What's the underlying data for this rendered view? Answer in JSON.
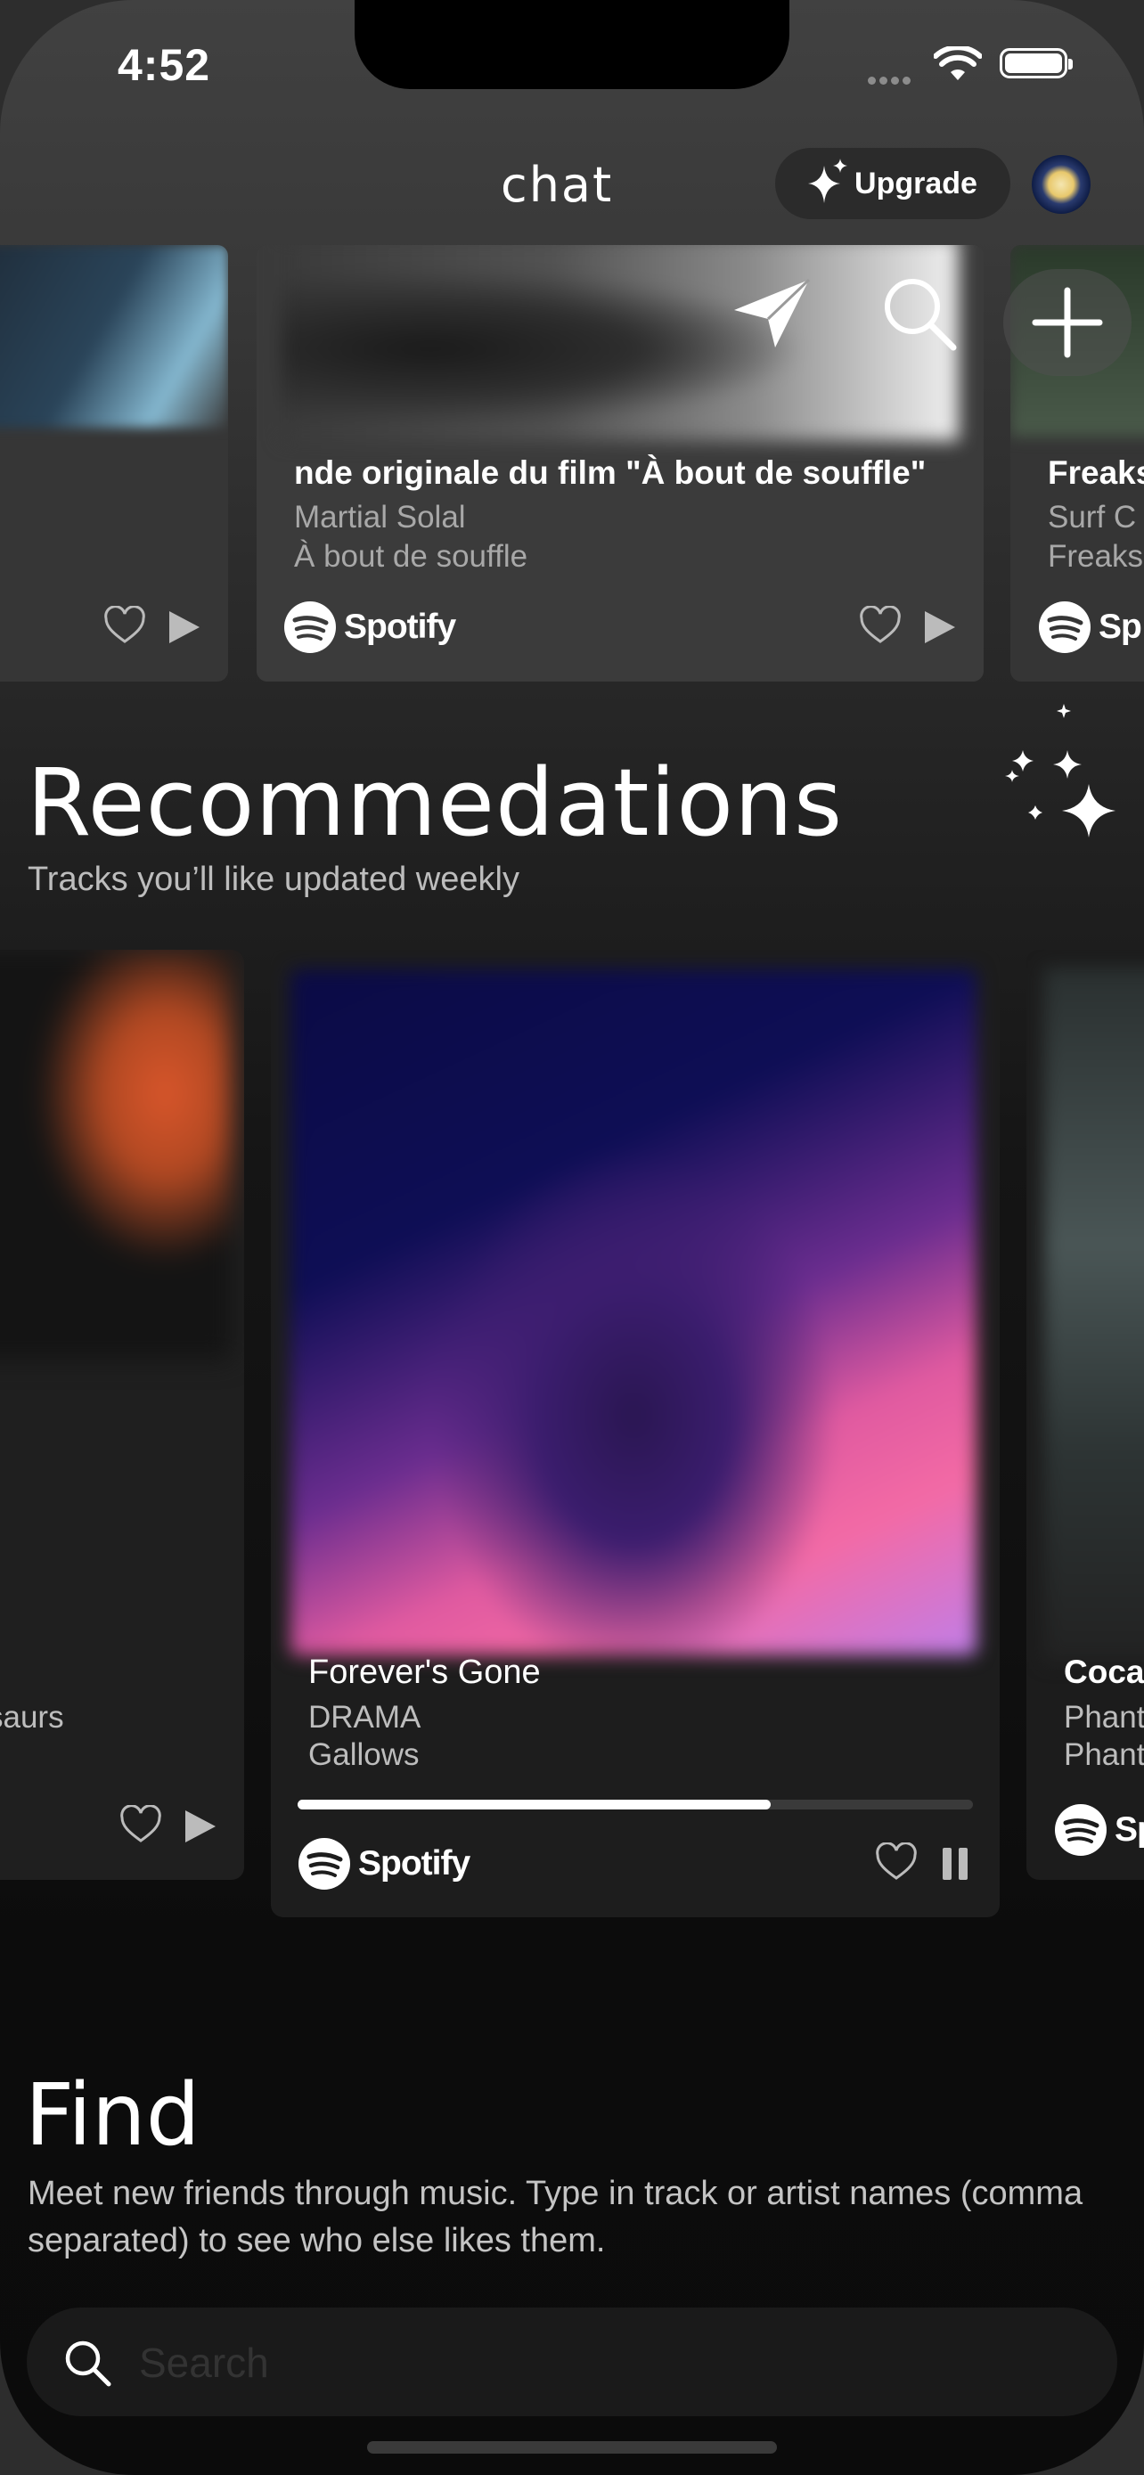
{
  "status_bar": {
    "time": "4:52"
  },
  "header": {
    "title": "chat",
    "upgrade_label": "Upgrade"
  },
  "top_cards": [
    {
      "title": "",
      "artist": "",
      "album": ""
    },
    {
      "title": "nde originale du film \"À bout de souffle\"",
      "artist": "Martial Solal",
      "album": "À bout de souffle",
      "spotify_label": "Spotify"
    },
    {
      "title": "Freaks",
      "artist": "Surf C",
      "album": "Freaks",
      "spotify_label": "Sp"
    }
  ],
  "recommendations": {
    "title": "Recommedations",
    "subtitle": "Tracks you’ll like updated weekly",
    "cards": [
      {
        "album": "saurs"
      },
      {
        "title": "Forever's Gone",
        "artist": "DRAMA",
        "album": "Gallows",
        "spotify_label": "Spotify",
        "progress": 0.7
      },
      {
        "title": "Coca",
        "artist": "Phant",
        "album": "Phant",
        "spotify_label": "Sp"
      }
    ]
  },
  "find": {
    "title": "Find",
    "description": "Meet new friends through music. Type in track or artist names (comma separated) to see who else likes them.",
    "search_placeholder": "Search"
  },
  "icons": {
    "send": "paper-plane-icon",
    "search": "search-icon",
    "add": "plus-icon",
    "sparkles": "sparkles-icon",
    "like": "heart-icon",
    "play": "play-icon",
    "pause": "pause-icon"
  }
}
